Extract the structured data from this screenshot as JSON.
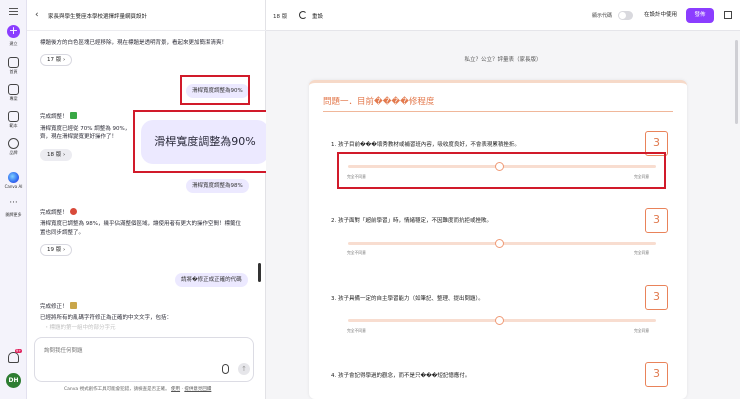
{
  "rail": {
    "create_label": "建立",
    "items": [
      {
        "label": "首頁",
        "icon": "home-icon"
      },
      {
        "label": "專案",
        "icon": "folder-icon"
      },
      {
        "label": "範本",
        "icon": "template-icon"
      },
      {
        "label": "品牌",
        "icon": "brand-icon"
      },
      {
        "label": "Canva AI",
        "icon": "canva-ai-icon"
      },
      {
        "label": "開牌更多",
        "icon": "more-icon"
      }
    ],
    "notification_badge": "9+",
    "avatar_initials": "DH"
  },
  "chat": {
    "title": "家長與學生雙座本學校選擇評量網頁設計",
    "messages": {
      "m1": "標題後方的白色區塊已經移除，現在標題是透明背景，看起來更加簡潔清爽！",
      "v17": "17 版",
      "user1": "滑桿寬度調整為90%",
      "m2_title": "完成調整！",
      "m2_body_1": "滑桿寬度已經從 70% 調整為 90%，",
      "m2_body_2": "齊，現在滑桿變寬更好操作了！",
      "v18": "18 版",
      "user2": "滑桿寬度調整為98%",
      "m3_title": "完成調整！",
      "m3_body_1": "滑桿寬度已調整為 98%，幾乎佔滿整個區域，讓使用者有更大的操作空間！標籤位",
      "m3_body_2": "置也同步調整了。",
      "v19": "19 版",
      "user3": "請將�修正成正確的代碼",
      "m4_title": "完成修正！",
      "m4_body_1": "已經將所有的亂碼字符修正為正確的中文文字，包括：",
      "m4_body_2": "・標題的第一組中的部分字元"
    },
    "composer_placeholder": "詢問我任何問題",
    "disclaimer": "Canva 視式創作工具可能會犯錯，請檢查是否正確。",
    "disclaimer_link_1": "使用",
    "disclaimer_link_2": "提供意見回饋"
  },
  "zoom": {
    "text": "滑桿寬度調整為90%"
  },
  "topbar": {
    "page": "18 版",
    "reset": "重設",
    "code_label": "顯示代碼",
    "use_in_design": "在設計中使用",
    "publish": "發佈"
  },
  "preview": {
    "school": "私立？公立？評量表（家長版）",
    "section_title": "問題一．目前����修程度",
    "scale_left": "完全不同意",
    "scale_right": "完全同意",
    "questions": [
      {
        "text": "1. 孩子目前���壞秀教材或補習班內容，吸收度良好，不會表現累積挫折。",
        "score": 3,
        "value": 3
      },
      {
        "text": "2. 孩子面對「超前學習」時，情緒穩定，不因難度而抗拒或挫敗。",
        "score": 3,
        "value": 3
      },
      {
        "text": "3. 孩子具備一定的自主學習能力（如筆記、整理、提出問題）。",
        "score": 3,
        "value": 3
      },
      {
        "text": "4. 孩子會記得學過的觀念，而不是只���短記憶應付。",
        "score": 3,
        "value": 3
      }
    ]
  },
  "colors": {
    "accent": "#8b3dff",
    "title_orange": "#e37a4e",
    "highlight_red": "#d11a2a",
    "user_bubble": "#ece9ff"
  }
}
